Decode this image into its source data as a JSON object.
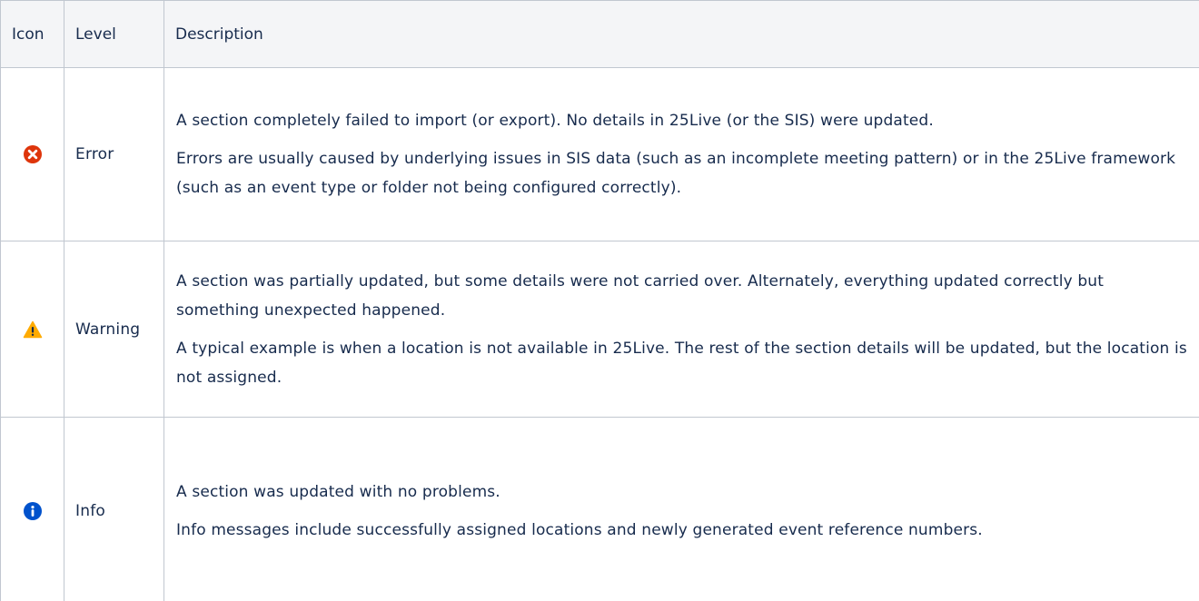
{
  "table": {
    "headers": {
      "icon": "Icon",
      "level": "Level",
      "description": "Description"
    },
    "rows": [
      {
        "icon": "error-icon",
        "icon_color": "#de350b",
        "level": "Error",
        "paragraphs": [
          "A section completely failed to import (or export). No details in 25Live (or the SIS) were updated.",
          "Errors are usually caused by underlying issues in SIS data (such as an incomplete meeting pattern) or in the 25Live framework (such as an event type or folder not being configured correctly)."
        ]
      },
      {
        "icon": "warning-icon",
        "icon_color": "#ffab00",
        "level": "Warning",
        "paragraphs": [
          "A section was partially updated, but some details were not carried over. Alternately, everything updated correctly but something unexpected happened.",
          "A typical example is when a location is not available in 25Live. The rest of the section details will be updated, but the location is not assigned."
        ]
      },
      {
        "icon": "info-icon",
        "icon_color": "#0052cc",
        "level": "Info",
        "paragraphs": [
          "A section was updated with no problems.",
          "Info messages include successfully assigned locations and newly generated event reference numbers."
        ]
      }
    ]
  }
}
